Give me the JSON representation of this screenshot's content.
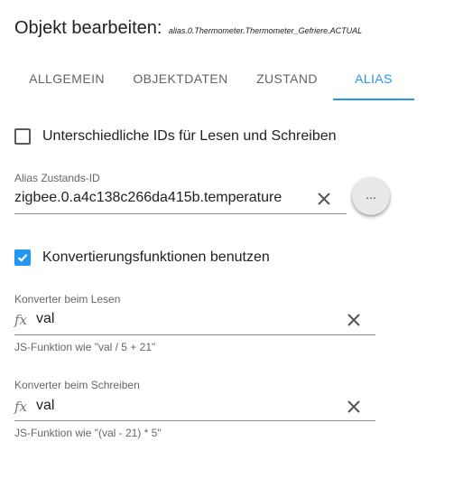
{
  "dialog": {
    "title": "Objekt bearbeiten:",
    "object_id": "alias.0.Thermometer.Thermometer_Gefriere.ACTUAL"
  },
  "tabs": [
    {
      "label": "ALLGEMEIN",
      "active": false
    },
    {
      "label": "OBJEKTDATEN",
      "active": false
    },
    {
      "label": "ZUSTAND",
      "active": false
    },
    {
      "label": "ALIAS",
      "active": true
    }
  ],
  "alias": {
    "different_ids": {
      "label": "Unterschiedliche IDs für Lesen und Schreiben",
      "checked": false
    },
    "state_id": {
      "label": "Alias Zustands-ID",
      "value": "zigbee.0.a4c138c266da415b.temperature",
      "more_label": "..."
    },
    "use_conversion": {
      "label": "Konvertierungsfunktionen benutzen",
      "checked": true
    },
    "read_converter": {
      "label": "Konverter beim Lesen",
      "value": "val",
      "helper": "JS-Funktion wie \"val / 5 + 21\""
    },
    "write_converter": {
      "label": "Konverter beim Schreiben",
      "value": "val",
      "helper": "JS-Funktion wie \"(val - 21) * 5\""
    }
  },
  "icons": {
    "fx": "function-icon",
    "clear": "close-icon",
    "check": "check-icon"
  },
  "colors": {
    "accent": "#2196f3",
    "text": "#212121",
    "muted": "#666666"
  }
}
